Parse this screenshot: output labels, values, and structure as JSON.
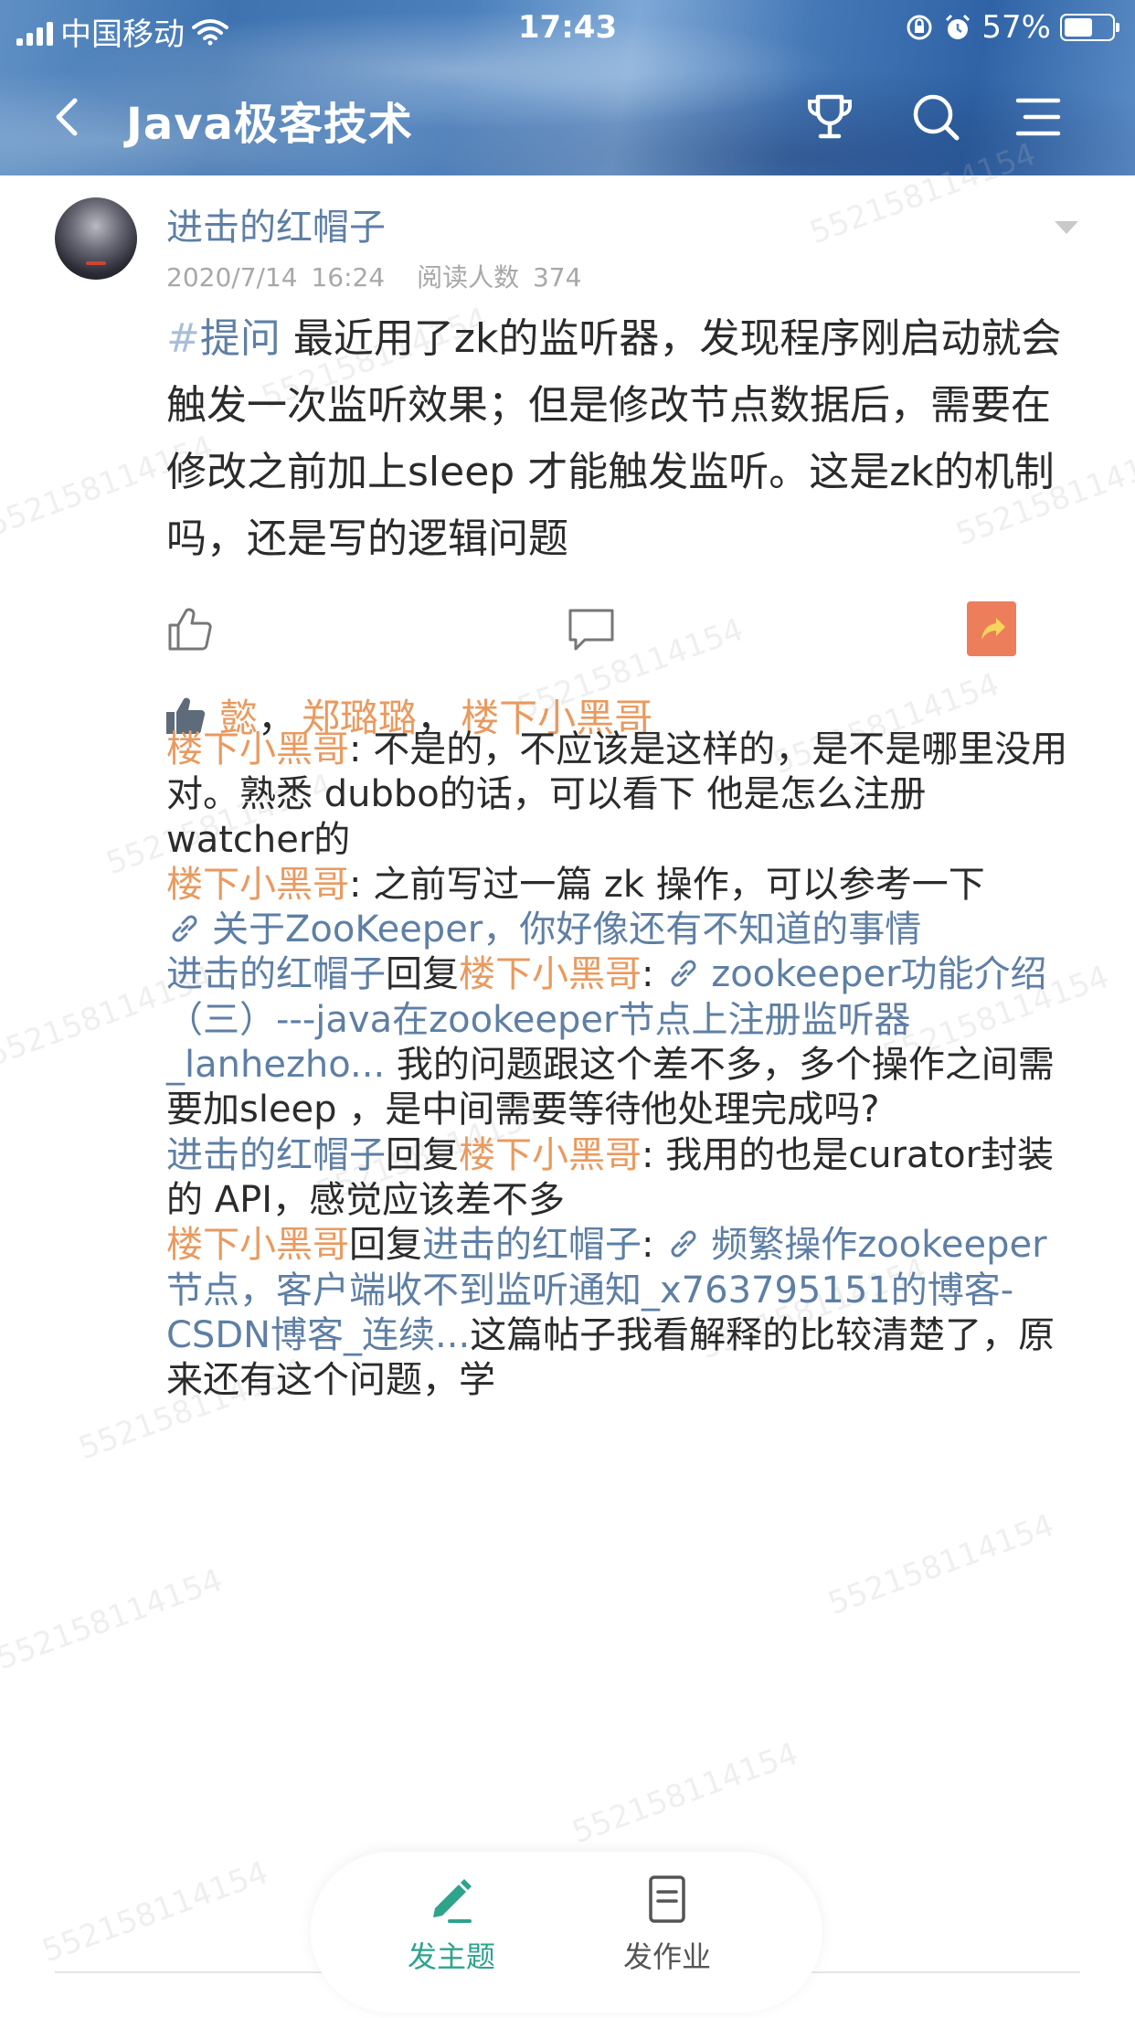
{
  "status_bar": {
    "carrier": "中国移动",
    "time": "17:43",
    "battery": "57%"
  },
  "nav": {
    "title": "Java极客技术",
    "back_icon": "chevron-left-icon",
    "icons": [
      "trophy-icon",
      "search-icon",
      "menu-icon"
    ]
  },
  "post": {
    "author": "进击的红帽子",
    "date": "2020/7/14 16:24",
    "reads": "阅读人数 374",
    "hash": "#",
    "hashtag": "提问",
    "body": " 最近用了zk的监听器，发现程序刚启动就会触发一次监听效果；但是修改节点数据后，需要在修改之前加上sleep 才能触发监听。这是zk的机制吗，还是写的逻辑问题"
  },
  "likes": {
    "users": [
      "懿",
      "郑璐璐",
      "楼下小黑哥"
    ],
    "separator": "，"
  },
  "comments": {
    "c1": {
      "author": "楼下小黑哥",
      "sep": ": ",
      "text": "不是的，不应该是这样的，是不是哪里没用对。熟悉 dubbo的话，可以看下 他是怎么注册 watcher的"
    },
    "c2": {
      "author": "楼下小黑哥",
      "sep": ": ",
      "text": "之前写过一篇 zk 操作，可以参考一下"
    },
    "c2_link": "关于ZooKeeper，你好像还有不知道的事情",
    "c3": {
      "author": "进击的红帽子",
      "reply": "回复",
      "target": "楼下小黑哥",
      "sep": ": ",
      "link": "zookeeper功能介绍（三）---java在zookeeper节点上注册监听器_lanhezho...",
      "text": "   我的问题跟这个差不多，多个操作之间需要加sleep ，是中间需要等待他处理完成吗?"
    },
    "c4": {
      "author": "进击的红帽子",
      "reply": "回复",
      "target": "楼下小黑哥",
      "sep": ": ",
      "text": "我用的也是curator封装的 API，感觉应该差不多"
    },
    "c5": {
      "author": "楼下小黑哥",
      "reply": "回复",
      "target": "进击的红帽子",
      "sep": ": ",
      "link": "频繁操作zookeeper节点，客户端收不到监听通知_x763795151的博客-CSDN博客_连续...",
      "text": "这篇帖子我看解释的比较清楚了，原来还有这个问题，学"
    }
  },
  "bottom_bar": {
    "tab1": "发主题",
    "tab2": "发作业"
  },
  "watermark": "552158114154",
  "colors": {
    "link_blue": "#5e7fa5",
    "accent_orange": "#e99a5f",
    "tab_green": "#2fa38c",
    "share_orange": "#ec7e5c"
  }
}
